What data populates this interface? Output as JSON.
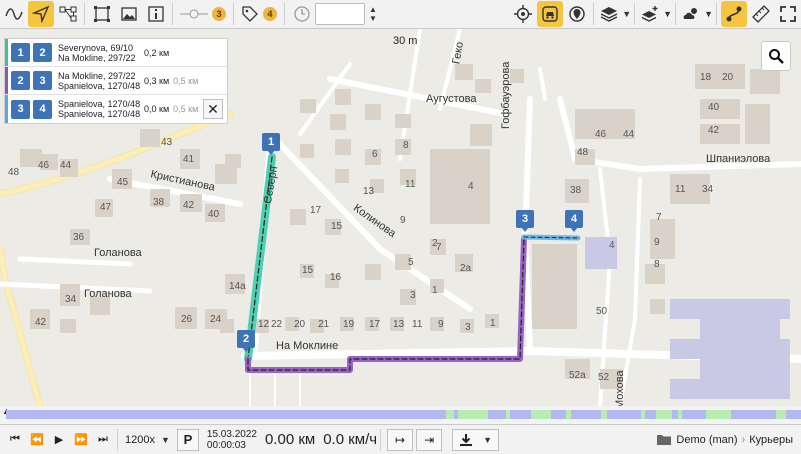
{
  "toolbar": {
    "left_tools": [
      "curve-icon",
      "navigate-icon",
      "node-graph-icon",
      "frame-icon",
      "image-icon",
      "info-icon"
    ],
    "geofence_count": "3",
    "tags_count": "4",
    "time_value": "",
    "right_tools": [
      "crosshair-icon",
      "vehicle-icon",
      "pin-icon",
      "layers-icon",
      "add-layer-icon",
      "weather-icon",
      "route-icon",
      "ruler-icon",
      "fullscreen-icon"
    ]
  },
  "map": {
    "scale": "30 m",
    "streets": {
      "avgustova": "Аугустова",
      "kristianova": "Кристианова",
      "kolinova": "Колинова",
      "golanova1": "Голанова",
      "golanova2": "Голанова",
      "na_mokline": "На Моклине",
      "gofbauerova": "Гофбауэрова",
      "shpanielova": "Шпаниэлова",
      "geko": "Геко",
      "sever": "Северн",
      "mokhova": "Мохова"
    },
    "house_numbers": [
      "48",
      "46",
      "44",
      "45",
      "47",
      "43",
      "41",
      "38",
      "42",
      "40",
      "36",
      "34",
      "42",
      "26",
      "24",
      "14a",
      "12",
      "22",
      "20",
      "21",
      "19",
      "17",
      "13",
      "11",
      "9",
      "3",
      "1",
      "17",
      "15",
      "13",
      "11",
      "9",
      "7",
      "15",
      "16",
      "5",
      "3",
      "1",
      "2a",
      "2",
      "8",
      "6",
      "4",
      "18",
      "20",
      "40",
      "42",
      "44",
      "46",
      "48",
      "38",
      "34",
      "11",
      "7",
      "9",
      "2",
      "6",
      "8",
      "4",
      "50",
      "52",
      "52a",
      "5",
      "3",
      "4",
      "16",
      "15",
      "18",
      "20",
      "14"
    ],
    "markers": [
      "1",
      "2",
      "3",
      "4"
    ]
  },
  "segments": [
    {
      "a": "1",
      "b": "2",
      "from": "Severynova, 69/10",
      "to": "Na Mokline, 297/22",
      "distance": "0,2 км",
      "alt": "",
      "color": "#3dbf9e"
    },
    {
      "a": "2",
      "b": "3",
      "from": "Na Mokline, 297/22",
      "to": "Spanielova, 1270/48",
      "distance": "0,3 км",
      "alt": "0,5 км",
      "color": "#8e58b8"
    },
    {
      "a": "3",
      "b": "4",
      "from": "Spanielova, 1270/48",
      "to": "Spanielova, 1270/48",
      "distance": "0,0 км",
      "alt": "0,5 км",
      "color": "#5aa7df"
    }
  ],
  "playback": {
    "speed": "1200x",
    "p_label": "P",
    "date": "15.03.2022",
    "time": "00:00:03",
    "distance": "0.00 км",
    "velocity": "0.0 км/ч"
  },
  "footer": {
    "folder": "Demo (man)",
    "sub": "Курьеры"
  },
  "colors": {
    "accent": "#f5c542",
    "marker": "#3e73b5",
    "track1": "#3dbf9e",
    "track2": "#8e58b8",
    "track3": "#5aa7df"
  }
}
